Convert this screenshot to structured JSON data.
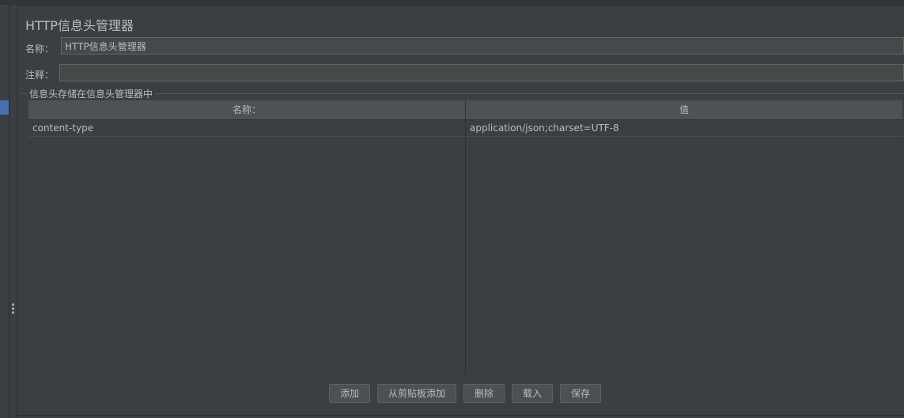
{
  "panel": {
    "title": "HTTP信息头管理器",
    "name_label": "名称：",
    "name_value": "HTTP信息头管理器",
    "comment_label": "注释：",
    "comment_value": ""
  },
  "headers_group": {
    "title": "信息头存储在信息头管理器中",
    "columns": [
      "名称：",
      "值"
    ],
    "rows": [
      {
        "name": "content-type",
        "value": "application/json;charset=UTF-8"
      }
    ]
  },
  "buttons": {
    "add": "添加",
    "add_from_clipboard": "从剪贴板添加",
    "delete": "删除",
    "load": "载入",
    "save": "保存"
  }
}
